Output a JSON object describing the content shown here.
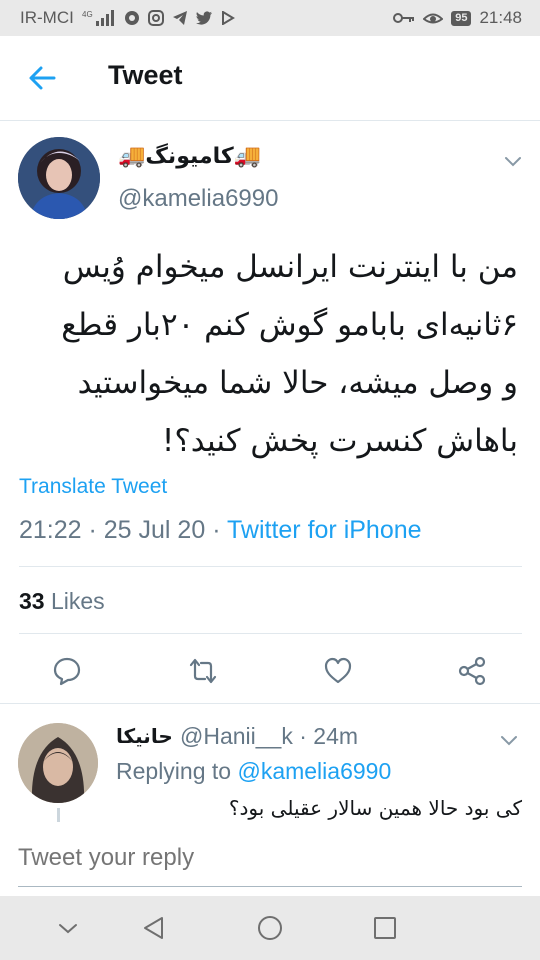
{
  "status_bar": {
    "carrier": "IR-MCI",
    "network": "4G",
    "battery": "95",
    "time": "21:48",
    "icons": [
      "signal-icon",
      "chrome-icon",
      "instagram-icon",
      "telegram-icon",
      "twitter-icon",
      "play-icon",
      "key-icon",
      "eye-icon",
      "battery-icon"
    ]
  },
  "header": {
    "back_icon": "arrow-left-icon",
    "title": "Tweet"
  },
  "tweet": {
    "display_name": "🚚کامیونگ🚚",
    "handle": "@kamelia6990",
    "text_lines": [
      "من با اینترنت ایرانسل میخوام وُیس",
      "۶ثانیه‌ای بابامو گوش کنم ۲۰بار قطع",
      "و وصل میشه، حالا شما میخواستید",
      "باهاش کنسرت پخش کنید؟!"
    ],
    "translate_label": "Translate Tweet",
    "timestamp": "21:22 · 25 Jul 20 · ",
    "source": "Twitter for iPhone",
    "likes_count": "33",
    "likes_label": " Likes",
    "actions": [
      "reply-icon",
      "retweet-icon",
      "like-icon",
      "share-icon"
    ]
  },
  "reply": {
    "name": "حانیکا",
    "handle": "@Hanii__k · 24m",
    "replying_prefix": "Replying to ",
    "replying_to": "@kamelia6990",
    "text": "کی بود حالا همین سالار عقیلی بود؟"
  },
  "composer": {
    "placeholder": "Tweet your reply"
  },
  "colors": {
    "accent": "#1da1f2",
    "secondary_text": "#657786",
    "divider": "#e1e8ed"
  }
}
